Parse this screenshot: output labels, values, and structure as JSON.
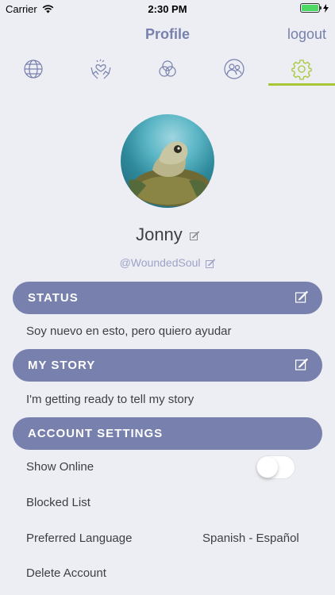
{
  "status_bar": {
    "carrier": "Carrier",
    "time": "2:30 PM"
  },
  "nav": {
    "title": "Profile",
    "logout": "logout"
  },
  "tabs": [
    {
      "icon": "globe-icon"
    },
    {
      "icon": "heart-hands-icon"
    },
    {
      "icon": "circles-icon"
    },
    {
      "icon": "friends-icon"
    },
    {
      "icon": "gear-icon",
      "active": true
    }
  ],
  "profile": {
    "name": "Jonny",
    "handle": "@WoundedSoul"
  },
  "status_section": {
    "title": "STATUS",
    "text": "Soy nuevo en esto, pero quiero ayudar"
  },
  "story_section": {
    "title": "MY STORY",
    "text": "I'm getting ready to tell my story"
  },
  "account_settings": {
    "title": "ACCOUNT SETTINGS",
    "show_online": "Show Online",
    "show_online_enabled": false,
    "blocked_list": "Blocked List",
    "preferred_language": "Preferred Language",
    "preferred_language_value": "Spanish - Español",
    "delete_account": "Delete Account"
  },
  "colors": {
    "accent": "#7880ad",
    "active_tab": "#a7c738",
    "background": "#eceef3"
  }
}
